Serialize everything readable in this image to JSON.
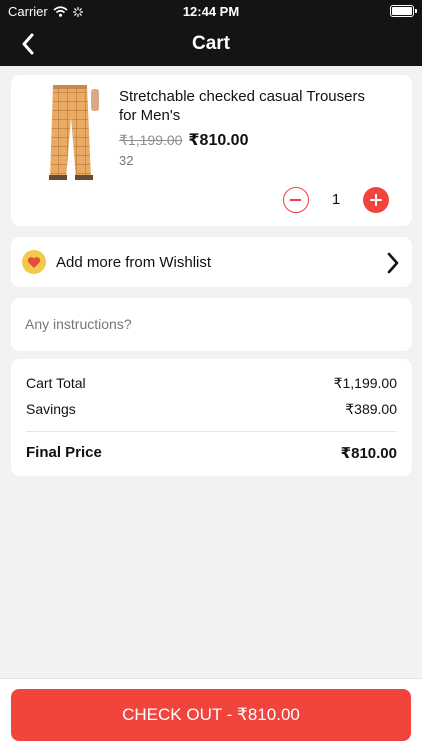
{
  "status_bar": {
    "carrier": "Carrier",
    "time": "12:44 PM",
    "wifi_icon": "wifi-icon",
    "activity_icon": "loading-spinner-icon",
    "battery_icon": "battery-icon"
  },
  "nav": {
    "title": "Cart",
    "back_icon": "chevron-left-icon"
  },
  "cart_item": {
    "name": "Stretchable checked casual Trousers for Men's",
    "original_price": "₹1,199.00",
    "price": "₹810.00",
    "size": "32",
    "quantity": "1",
    "image": "checked-trousers-photo"
  },
  "wishlist": {
    "label": "Add more from Wishlist",
    "icon": "heart-icon"
  },
  "instructions": {
    "placeholder": "Any instructions?"
  },
  "summary": {
    "cart_total_label": "Cart Total",
    "cart_total_value": "₹1,199.00",
    "savings_label": "Savings",
    "savings_value": "₹389.00",
    "final_label": "Final Price",
    "final_value": "₹810.00"
  },
  "checkout": {
    "label": "CHECK OUT - ₹810.00"
  },
  "colors": {
    "accent": "#f0443c",
    "header": "#141414",
    "background": "#f2f2f2",
    "trousers": "#e8a860"
  }
}
